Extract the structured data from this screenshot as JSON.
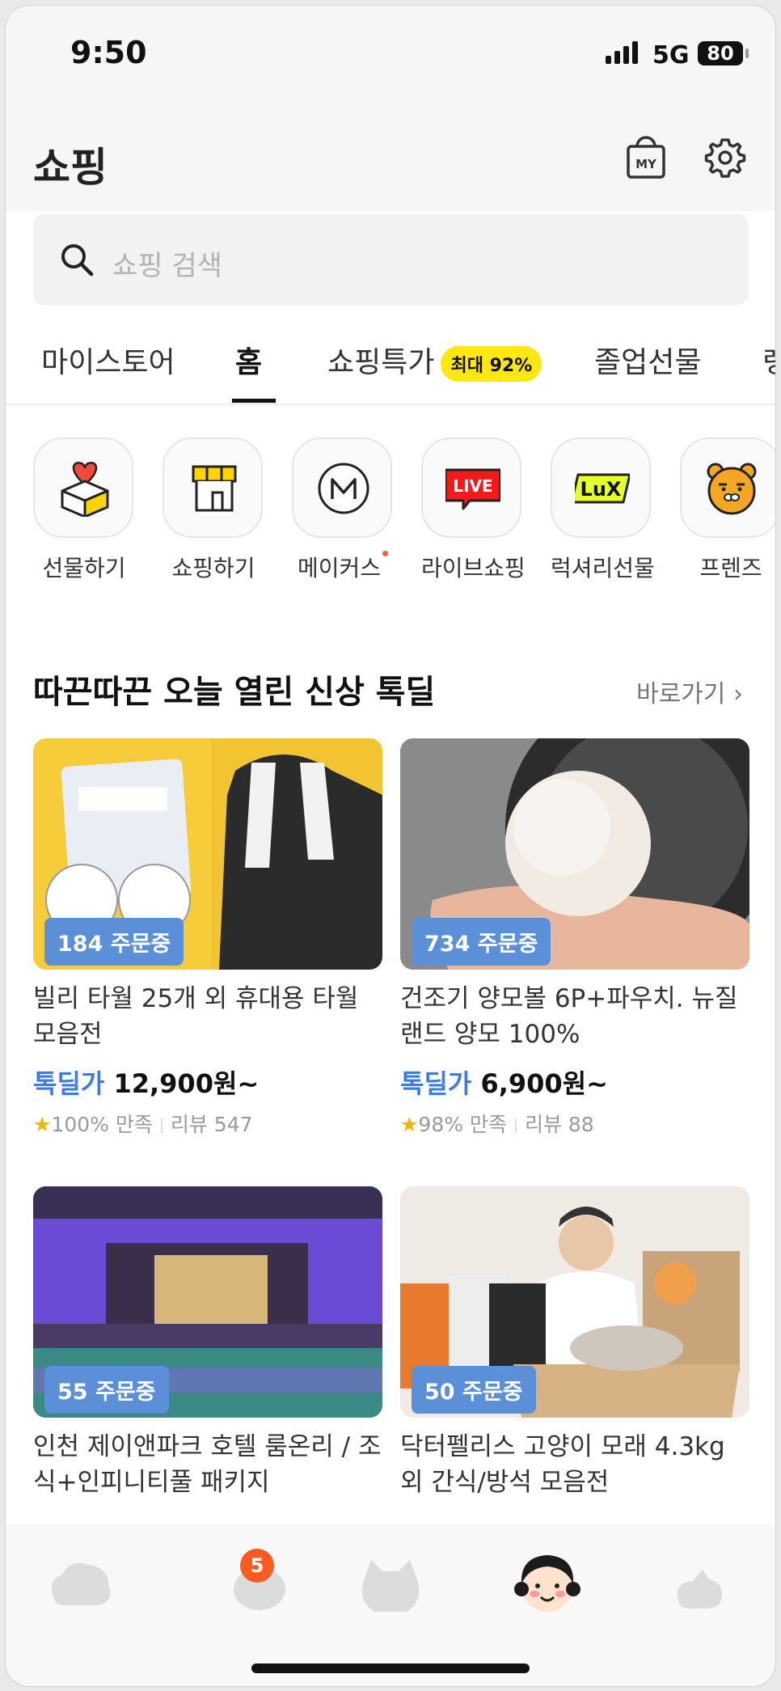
{
  "status": {
    "time": "9:50",
    "network": "5G",
    "battery": "80"
  },
  "header": {
    "title": "쇼핑",
    "my_label": "MY"
  },
  "search": {
    "placeholder": "쇼핑 검색"
  },
  "tabs": [
    {
      "label": "마이스토어"
    },
    {
      "label": "홈",
      "active": true
    },
    {
      "label": "쇼핑특가",
      "badge": "최대 92%"
    },
    {
      "label": "졸업선물"
    },
    {
      "label": "랭"
    }
  ],
  "categories": [
    {
      "label": "선물하기",
      "icon": "gift-box-icon"
    },
    {
      "label": "쇼핑하기",
      "icon": "store-awning-icon"
    },
    {
      "label": "메이커스",
      "icon": "makers-m-icon",
      "new_dot": true
    },
    {
      "label": "라이브쇼핑",
      "icon": "live-badge-icon",
      "icon_text": "LIVE"
    },
    {
      "label": "럭셔리선물",
      "icon": "lux-badge-icon",
      "icon_text": "LuX"
    },
    {
      "label": "프렌즈",
      "icon": "ryan-face-icon"
    }
  ],
  "section": {
    "title": "따끈따끈 오늘 열린 신상 톡딜",
    "link": "바로가기"
  },
  "products": [
    {
      "orders": "184 주문중",
      "name": "빌리 타월 25개 외 휴대용 타월 모음전",
      "price_label": "톡딜가",
      "price": "12,900원~",
      "satisfaction": "100% 만족",
      "reviews": "리뷰 547"
    },
    {
      "orders": "734 주문중",
      "name": "건조기 양모볼 6P+파우치. 뉴질랜드 양모 100%",
      "price_label": "톡딜가",
      "price": "6,900원~",
      "satisfaction": "98% 만족",
      "reviews": "리뷰 88"
    },
    {
      "orders": "55 주문중",
      "name": "인천 제이앤파크 호텔 룸온리 / 조식+인피니티풀 패키지"
    },
    {
      "orders": "50 주문중",
      "name": "닥터펠리스 고양이 모래 4.3kg 외 간식/방석 모음전"
    }
  ],
  "bottom_nav": {
    "badge_count": "5"
  },
  "colors": {
    "accent": "#3c7de2",
    "badge_yellow": "#ffe812",
    "order_pill": "#5b8fd8",
    "notify": "#ff5a1f"
  }
}
